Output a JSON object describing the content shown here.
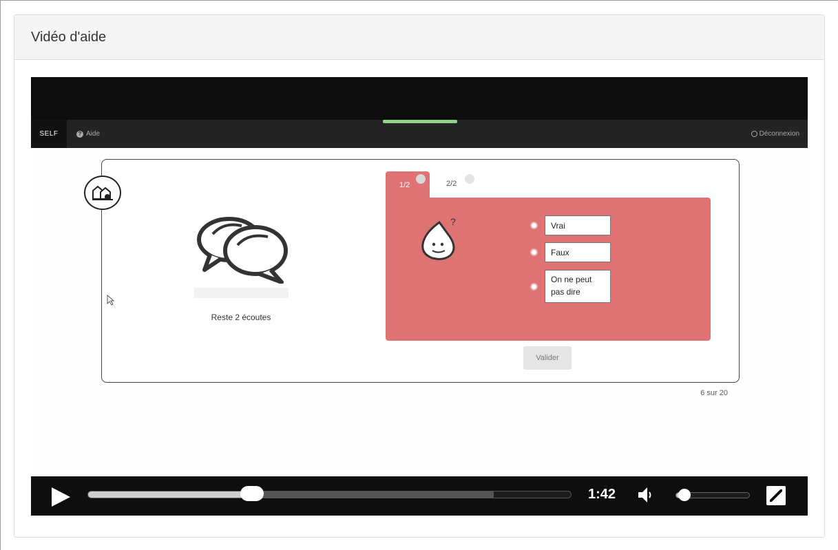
{
  "panel": {
    "title": "Vidéo d'aide"
  },
  "app": {
    "brand": "SELF",
    "help_label": "Aide",
    "logout_label": "Déconnexion",
    "help_icon": "question-circle-icon",
    "logout_icon": "power-icon"
  },
  "exercise": {
    "remaining_listens": "Reste 2 écoutes",
    "tabs": [
      {
        "label": "1/2",
        "active": true
      },
      {
        "label": "2/2",
        "active": false
      }
    ],
    "options": [
      {
        "label_lines": [
          "Vrai"
        ]
      },
      {
        "label_lines": [
          "Faux"
        ]
      },
      {
        "label_lines": [
          "On ne peut",
          "pas dire"
        ]
      }
    ],
    "validate_label": "Valider",
    "progress": "6 sur 20",
    "question_color": "#df7373"
  },
  "player": {
    "time": "1:42",
    "played_fraction": 0.34,
    "buffered_fraction": 0.84,
    "volume_fraction": 0.12,
    "icons": {
      "play": "play-icon",
      "volume": "volume-icon",
      "fullscreen": "fullscreen-icon"
    }
  }
}
